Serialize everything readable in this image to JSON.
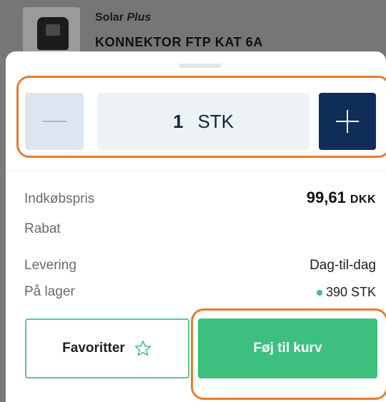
{
  "product": {
    "brand_name": "Solar",
    "brand_suffix": "Plus",
    "name": "KONNEKTOR FTP KAT 6A"
  },
  "stepper": {
    "quantity": "1",
    "unit": "STK",
    "minus_icon": "minus-icon",
    "plus_icon": "plus-icon"
  },
  "details": {
    "purchase_price_label": "Indkøbspris",
    "purchase_price_value": "99,61",
    "purchase_price_currency": "DKK",
    "discount_label": "Rabat",
    "delivery_label": "Levering",
    "delivery_value": "Dag-til-dag",
    "stock_label": "På lager",
    "stock_value": "390 STK"
  },
  "actions": {
    "favorites_label": "Favoritter",
    "add_to_cart_label": "Føj til kurv"
  },
  "colors": {
    "accent_green": "#3cbf7f",
    "navy": "#0f2d57",
    "highlight_orange": "#e87b2a"
  }
}
